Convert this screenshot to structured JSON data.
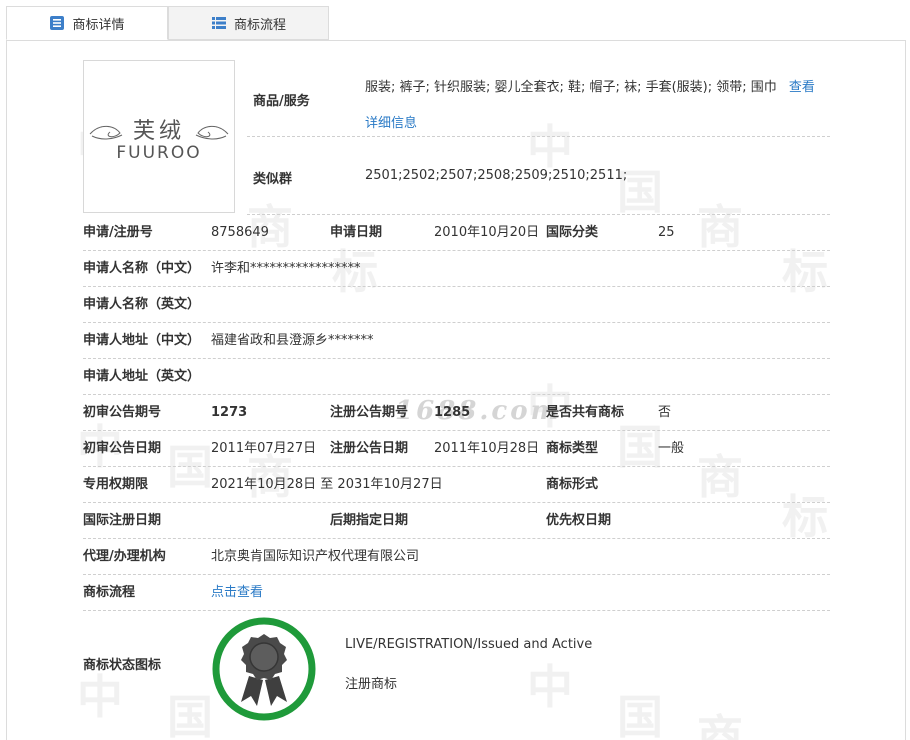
{
  "tabs": [
    {
      "label": "商标详情",
      "active": true,
      "icon": "document-icon"
    },
    {
      "label": "商标流程",
      "active": false,
      "icon": "list-icon"
    }
  ],
  "watermark": {
    "char_left": "中",
    "char_right": "国",
    "char_a": "商",
    "char_b": "标",
    "site": "1688.com"
  },
  "logo": {
    "cn": "芙绒",
    "en": "FUUROO"
  },
  "goods": {
    "label": "商品/服务",
    "text": "服装; 裤子; 针织服装; 婴儿全套衣; 鞋; 帽子; 袜; 手套(服装); 领带; 围巾",
    "link": "查看详细信息"
  },
  "similar_group": {
    "label": "类似群",
    "value": "2501;2502;2507;2508;2509;2510;2511;"
  },
  "fields": {
    "reg_no_label": "申请/注册号",
    "reg_no": "8758649",
    "apply_date_label": "申请日期",
    "apply_date": "2010年10月20日",
    "intl_class_label": "国际分类",
    "intl_class": "25",
    "applicant_cn_label": "申请人名称（中文）",
    "applicant_cn": "许李和*****************",
    "applicant_en_label": "申请人名称（英文）",
    "applicant_en": "",
    "address_cn_label": "申请人地址（中文）",
    "address_cn": "福建省政和县澄源乡*******",
    "address_en_label": "申请人地址（英文）",
    "address_en": "",
    "prelim_no_label": "初审公告期号",
    "prelim_no": "1273",
    "reg_notice_no_label": "注册公告期号",
    "reg_notice_no": "1285",
    "shared_label": "是否共有商标",
    "shared": "否",
    "prelim_date_label": "初审公告日期",
    "prelim_date": "2011年07月27日",
    "reg_notice_date_label": "注册公告日期",
    "reg_notice_date": "2011年10月28日",
    "tm_type_label": "商标类型",
    "tm_type": "一般",
    "exclusive_label": "专用权期限",
    "exclusive": "2021年10月28日 至 2031年10月27日",
    "tm_form_label": "商标形式",
    "tm_form": "",
    "intl_reg_date_label": "国际注册日期",
    "intl_reg_date": "",
    "later_designation_label": "后期指定日期",
    "later_designation": "",
    "priority_label": "优先权日期",
    "priority": "",
    "agent_label": "代理/办理机构",
    "agent": "北京奥肯国际知识产权代理有限公司",
    "process_label": "商标流程",
    "process_link": "点击查看",
    "status_label": "商标状态图标",
    "status_en": "LIVE/REGISTRATION/Issued and Active",
    "status_cn": "注册商标"
  },
  "colors": {
    "link": "#2a7ac6",
    "badge_ring": "#1f9a3a",
    "badge_seal": "#4a4a4a"
  }
}
